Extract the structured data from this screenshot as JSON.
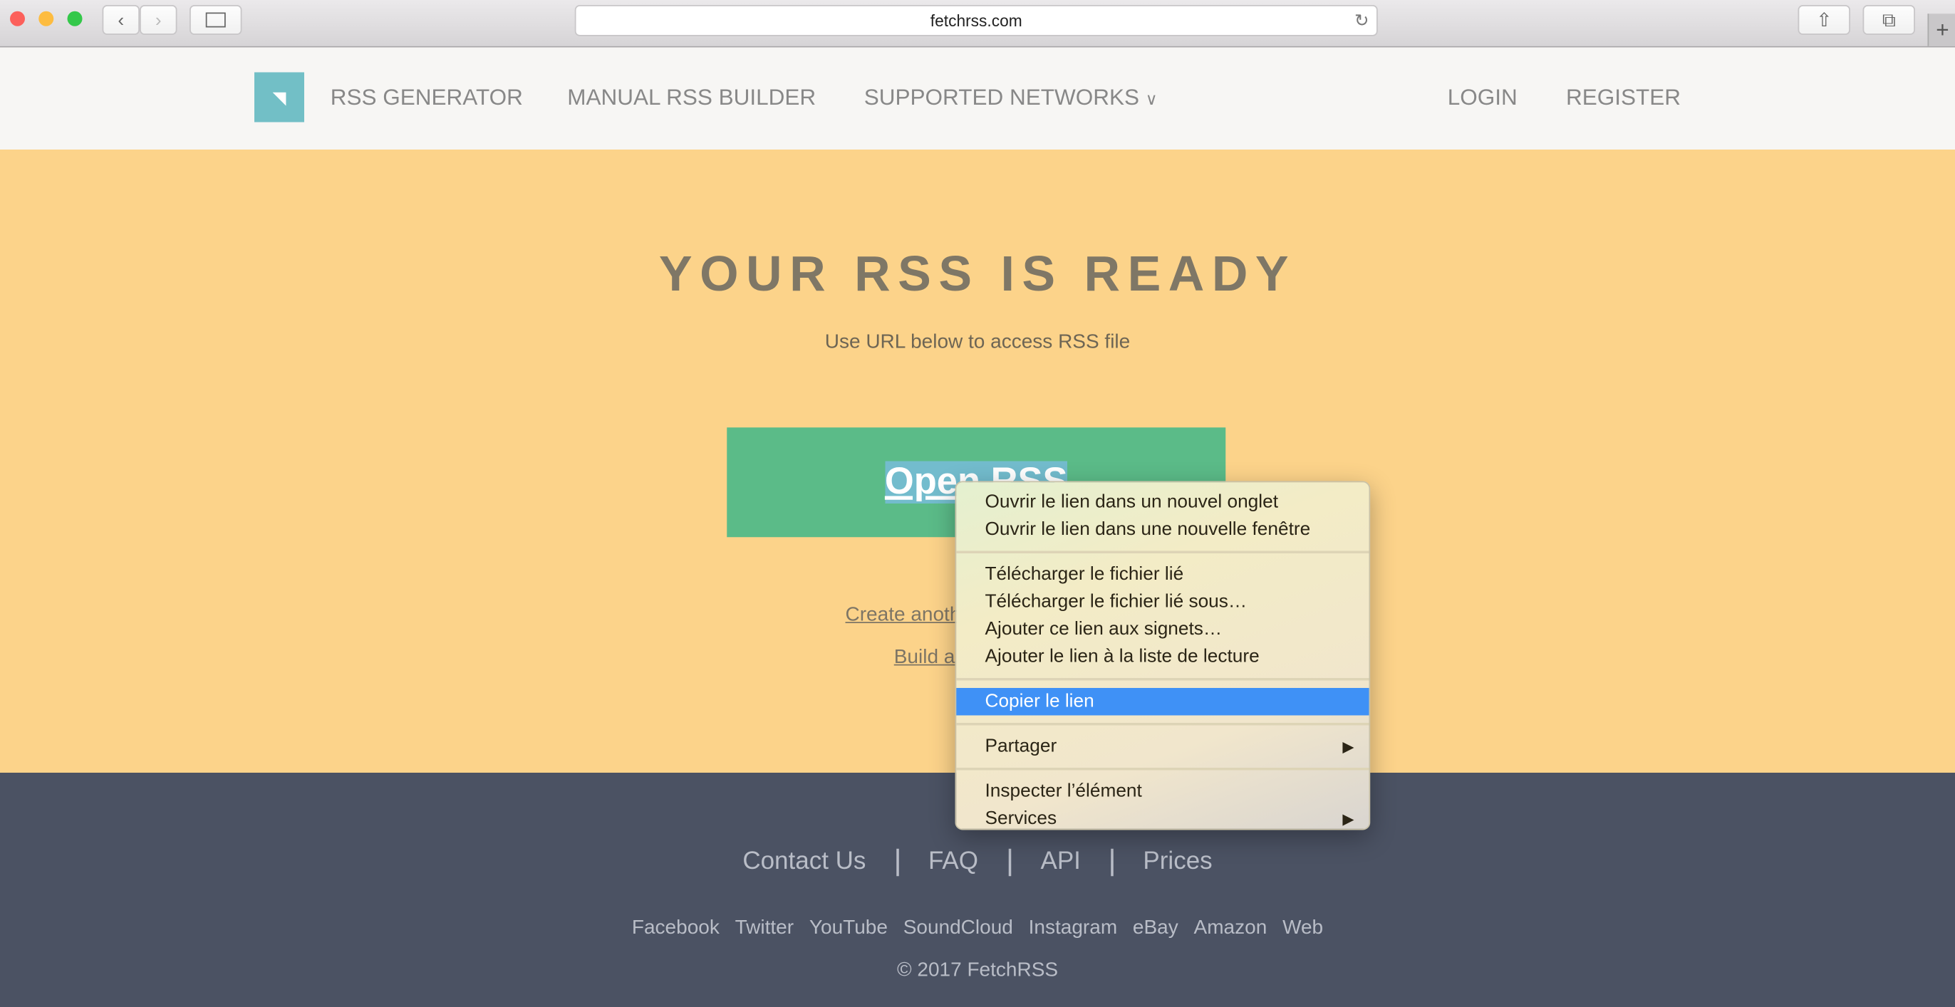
{
  "browser": {
    "url": "fetchrss.com",
    "traffic_lights": [
      "#fc605b",
      "#fdbc40",
      "#34c84a"
    ]
  },
  "nav": {
    "links": [
      "RSS GENERATOR",
      "MANUAL RSS BUILDER",
      "SUPPORTED NETWORKS"
    ],
    "login": "LOGIN",
    "register": "REGISTER",
    "logo_color": "#72bfc6"
  },
  "hero": {
    "title": "YOUR RSS IS READY",
    "subtitle": "Use URL below to access RSS file",
    "button": "Open RSS",
    "link1": "Create anoth",
    "link2": "Build a",
    "bg": "#fcd38a",
    "button_color": "#5bbb88"
  },
  "context_menu": {
    "groups": [
      [
        "Ouvrir le lien dans un nouvel onglet",
        "Ouvrir le lien dans une nouvelle fenêtre"
      ],
      [
        "Télécharger le fichier lié",
        "Télécharger le fichier lié sous…",
        "Ajouter ce lien aux signets…",
        "Ajouter le lien à la liste de lecture"
      ],
      [
        "Copier le lien"
      ],
      [
        "Partager"
      ],
      [
        "Inspecter l’élément",
        "Services"
      ]
    ],
    "selected": "Copier le lien",
    "highlight": "#3f91f6"
  },
  "footer": {
    "main": [
      "Contact Us",
      "FAQ",
      "API",
      "Prices"
    ],
    "social": [
      "Facebook",
      "Twitter",
      "YouTube",
      "SoundCloud",
      "Instagram",
      "eBay",
      "Amazon",
      "Web"
    ],
    "copyright": "© 2017 FetchRSS",
    "bg": "#4b5263"
  }
}
